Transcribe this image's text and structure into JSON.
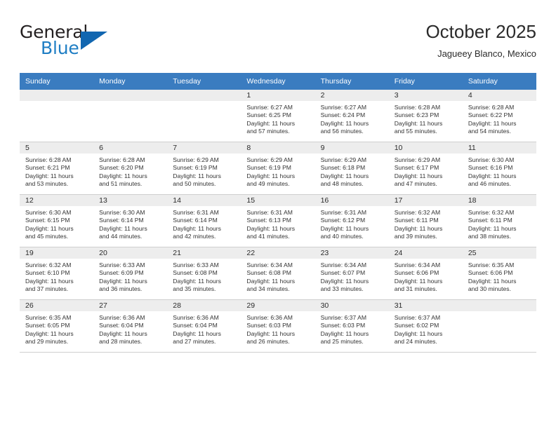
{
  "brand": {
    "name_top": "General",
    "name_bottom": "Blue",
    "accent_color": "#1166b0",
    "blue_text_color": "#1f7ec4"
  },
  "header": {
    "month_title": "October 2025",
    "location": "Jagueey Blanco, Mexico"
  },
  "calendar": {
    "header_bg": "#3a7cc0",
    "daynum_bg": "#ededed",
    "weekday_headers": [
      "Sunday",
      "Monday",
      "Tuesday",
      "Wednesday",
      "Thursday",
      "Friday",
      "Saturday"
    ],
    "weeks": [
      [
        {
          "day": "",
          "sunrise": "",
          "sunset": "",
          "daylight_line1": "",
          "daylight_line2": ""
        },
        {
          "day": "",
          "sunrise": "",
          "sunset": "",
          "daylight_line1": "",
          "daylight_line2": ""
        },
        {
          "day": "",
          "sunrise": "",
          "sunset": "",
          "daylight_line1": "",
          "daylight_line2": ""
        },
        {
          "day": "1",
          "sunrise": "Sunrise: 6:27 AM",
          "sunset": "Sunset: 6:25 PM",
          "daylight_line1": "Daylight: 11 hours",
          "daylight_line2": "and 57 minutes."
        },
        {
          "day": "2",
          "sunrise": "Sunrise: 6:27 AM",
          "sunset": "Sunset: 6:24 PM",
          "daylight_line1": "Daylight: 11 hours",
          "daylight_line2": "and 56 minutes."
        },
        {
          "day": "3",
          "sunrise": "Sunrise: 6:28 AM",
          "sunset": "Sunset: 6:23 PM",
          "daylight_line1": "Daylight: 11 hours",
          "daylight_line2": "and 55 minutes."
        },
        {
          "day": "4",
          "sunrise": "Sunrise: 6:28 AM",
          "sunset": "Sunset: 6:22 PM",
          "daylight_line1": "Daylight: 11 hours",
          "daylight_line2": "and 54 minutes."
        }
      ],
      [
        {
          "day": "5",
          "sunrise": "Sunrise: 6:28 AM",
          "sunset": "Sunset: 6:21 PM",
          "daylight_line1": "Daylight: 11 hours",
          "daylight_line2": "and 53 minutes."
        },
        {
          "day": "6",
          "sunrise": "Sunrise: 6:28 AM",
          "sunset": "Sunset: 6:20 PM",
          "daylight_line1": "Daylight: 11 hours",
          "daylight_line2": "and 51 minutes."
        },
        {
          "day": "7",
          "sunrise": "Sunrise: 6:29 AM",
          "sunset": "Sunset: 6:19 PM",
          "daylight_line1": "Daylight: 11 hours",
          "daylight_line2": "and 50 minutes."
        },
        {
          "day": "8",
          "sunrise": "Sunrise: 6:29 AM",
          "sunset": "Sunset: 6:19 PM",
          "daylight_line1": "Daylight: 11 hours",
          "daylight_line2": "and 49 minutes."
        },
        {
          "day": "9",
          "sunrise": "Sunrise: 6:29 AM",
          "sunset": "Sunset: 6:18 PM",
          "daylight_line1": "Daylight: 11 hours",
          "daylight_line2": "and 48 minutes."
        },
        {
          "day": "10",
          "sunrise": "Sunrise: 6:29 AM",
          "sunset": "Sunset: 6:17 PM",
          "daylight_line1": "Daylight: 11 hours",
          "daylight_line2": "and 47 minutes."
        },
        {
          "day": "11",
          "sunrise": "Sunrise: 6:30 AM",
          "sunset": "Sunset: 6:16 PM",
          "daylight_line1": "Daylight: 11 hours",
          "daylight_line2": "and 46 minutes."
        }
      ],
      [
        {
          "day": "12",
          "sunrise": "Sunrise: 6:30 AM",
          "sunset": "Sunset: 6:15 PM",
          "daylight_line1": "Daylight: 11 hours",
          "daylight_line2": "and 45 minutes."
        },
        {
          "day": "13",
          "sunrise": "Sunrise: 6:30 AM",
          "sunset": "Sunset: 6:14 PM",
          "daylight_line1": "Daylight: 11 hours",
          "daylight_line2": "and 44 minutes."
        },
        {
          "day": "14",
          "sunrise": "Sunrise: 6:31 AM",
          "sunset": "Sunset: 6:14 PM",
          "daylight_line1": "Daylight: 11 hours",
          "daylight_line2": "and 42 minutes."
        },
        {
          "day": "15",
          "sunrise": "Sunrise: 6:31 AM",
          "sunset": "Sunset: 6:13 PM",
          "daylight_line1": "Daylight: 11 hours",
          "daylight_line2": "and 41 minutes."
        },
        {
          "day": "16",
          "sunrise": "Sunrise: 6:31 AM",
          "sunset": "Sunset: 6:12 PM",
          "daylight_line1": "Daylight: 11 hours",
          "daylight_line2": "and 40 minutes."
        },
        {
          "day": "17",
          "sunrise": "Sunrise: 6:32 AM",
          "sunset": "Sunset: 6:11 PM",
          "daylight_line1": "Daylight: 11 hours",
          "daylight_line2": "and 39 minutes."
        },
        {
          "day": "18",
          "sunrise": "Sunrise: 6:32 AM",
          "sunset": "Sunset: 6:11 PM",
          "daylight_line1": "Daylight: 11 hours",
          "daylight_line2": "and 38 minutes."
        }
      ],
      [
        {
          "day": "19",
          "sunrise": "Sunrise: 6:32 AM",
          "sunset": "Sunset: 6:10 PM",
          "daylight_line1": "Daylight: 11 hours",
          "daylight_line2": "and 37 minutes."
        },
        {
          "day": "20",
          "sunrise": "Sunrise: 6:33 AM",
          "sunset": "Sunset: 6:09 PM",
          "daylight_line1": "Daylight: 11 hours",
          "daylight_line2": "and 36 minutes."
        },
        {
          "day": "21",
          "sunrise": "Sunrise: 6:33 AM",
          "sunset": "Sunset: 6:08 PM",
          "daylight_line1": "Daylight: 11 hours",
          "daylight_line2": "and 35 minutes."
        },
        {
          "day": "22",
          "sunrise": "Sunrise: 6:34 AM",
          "sunset": "Sunset: 6:08 PM",
          "daylight_line1": "Daylight: 11 hours",
          "daylight_line2": "and 34 minutes."
        },
        {
          "day": "23",
          "sunrise": "Sunrise: 6:34 AM",
          "sunset": "Sunset: 6:07 PM",
          "daylight_line1": "Daylight: 11 hours",
          "daylight_line2": "and 33 minutes."
        },
        {
          "day": "24",
          "sunrise": "Sunrise: 6:34 AM",
          "sunset": "Sunset: 6:06 PM",
          "daylight_line1": "Daylight: 11 hours",
          "daylight_line2": "and 31 minutes."
        },
        {
          "day": "25",
          "sunrise": "Sunrise: 6:35 AM",
          "sunset": "Sunset: 6:06 PM",
          "daylight_line1": "Daylight: 11 hours",
          "daylight_line2": "and 30 minutes."
        }
      ],
      [
        {
          "day": "26",
          "sunrise": "Sunrise: 6:35 AM",
          "sunset": "Sunset: 6:05 PM",
          "daylight_line1": "Daylight: 11 hours",
          "daylight_line2": "and 29 minutes."
        },
        {
          "day": "27",
          "sunrise": "Sunrise: 6:36 AM",
          "sunset": "Sunset: 6:04 PM",
          "daylight_line1": "Daylight: 11 hours",
          "daylight_line2": "and 28 minutes."
        },
        {
          "day": "28",
          "sunrise": "Sunrise: 6:36 AM",
          "sunset": "Sunset: 6:04 PM",
          "daylight_line1": "Daylight: 11 hours",
          "daylight_line2": "and 27 minutes."
        },
        {
          "day": "29",
          "sunrise": "Sunrise: 6:36 AM",
          "sunset": "Sunset: 6:03 PM",
          "daylight_line1": "Daylight: 11 hours",
          "daylight_line2": "and 26 minutes."
        },
        {
          "day": "30",
          "sunrise": "Sunrise: 6:37 AM",
          "sunset": "Sunset: 6:03 PM",
          "daylight_line1": "Daylight: 11 hours",
          "daylight_line2": "and 25 minutes."
        },
        {
          "day": "31",
          "sunrise": "Sunrise: 6:37 AM",
          "sunset": "Sunset: 6:02 PM",
          "daylight_line1": "Daylight: 11 hours",
          "daylight_line2": "and 24 minutes."
        },
        {
          "day": "",
          "sunrise": "",
          "sunset": "",
          "daylight_line1": "",
          "daylight_line2": ""
        }
      ]
    ]
  }
}
